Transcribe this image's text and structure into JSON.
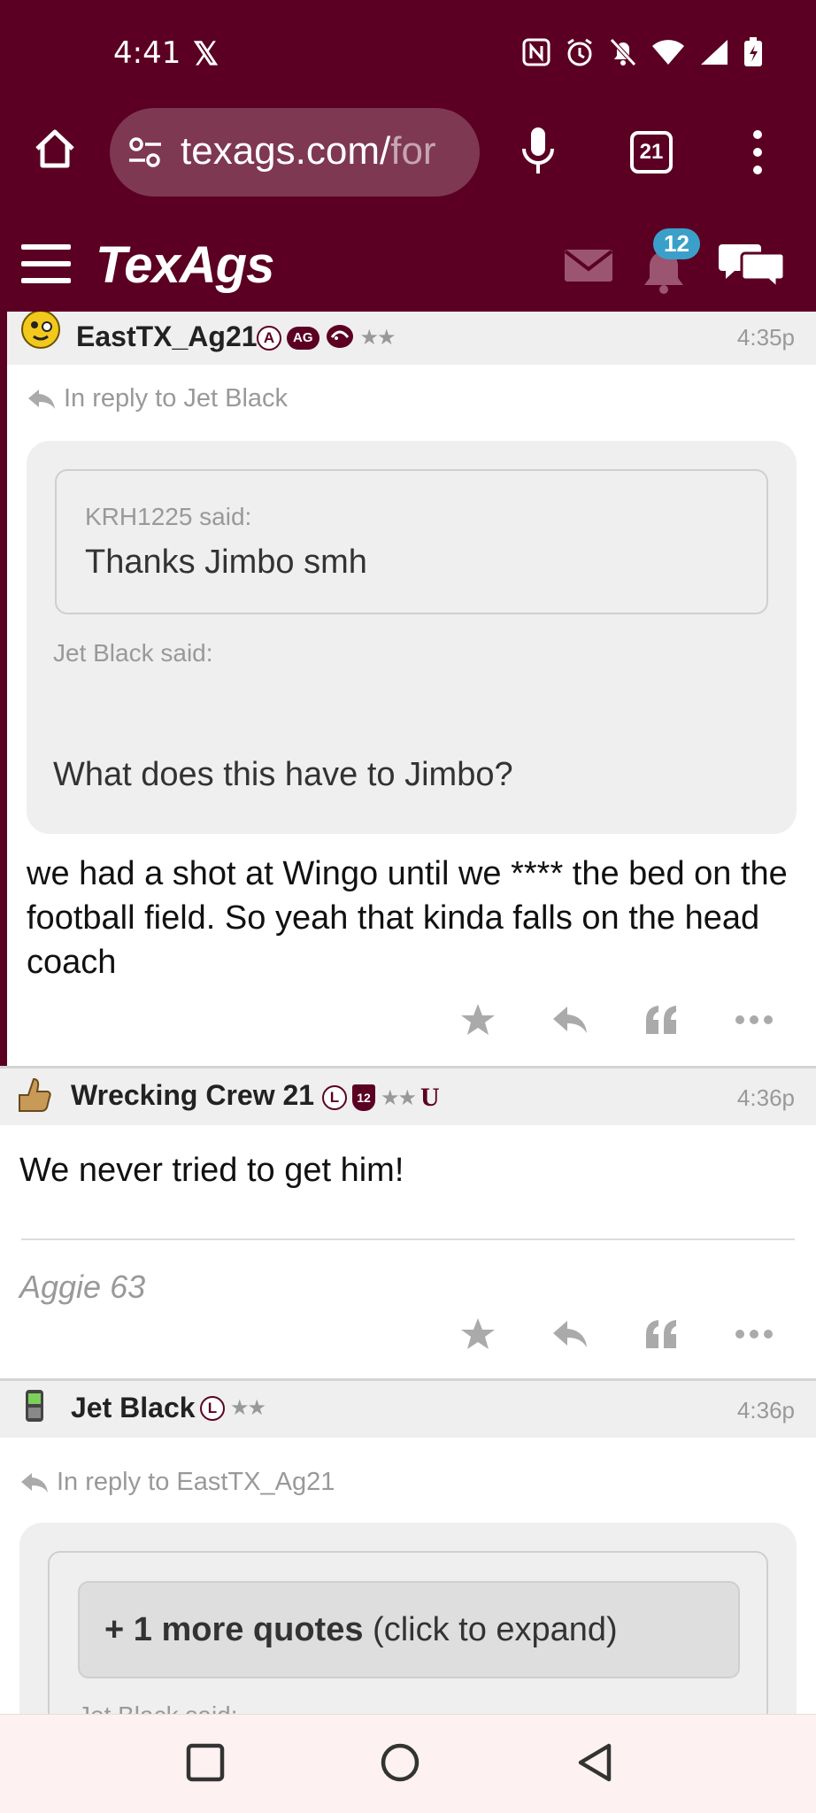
{
  "status_bar": {
    "time": "4:41",
    "x_app": "𝕏",
    "icons": [
      "nfc-icon",
      "alarm-icon",
      "mute-icon",
      "wifi-icon",
      "signal-icon",
      "battery-charging-icon"
    ]
  },
  "browser": {
    "url_main": "texags.com/",
    "url_fade": "for",
    "tab_count": "21"
  },
  "site": {
    "logo": "TexAgs",
    "notification_count": "12",
    "brand_color": "#5b0022",
    "badge_color": "#3ba0c9"
  },
  "posts": [
    {
      "username": "EastTX_Ag21",
      "badge_letter": "A",
      "badge_pill": "AG",
      "stars": "★★",
      "time": "4:35p",
      "reply_to": "In reply to Jet Black",
      "inner_quote_author": "KRH1225 said:",
      "inner_quote_text": "Thanks Jimbo smh",
      "outer_quote_author": "Jet Black said:",
      "outer_quote_text": "What does this have to Jimbo?",
      "body": "we had a shot at Wingo until we **** the bed on the football field. So yeah that kinda falls on the head coach"
    },
    {
      "username": "Wrecking Crew 21",
      "badge_letter": "L",
      "badge_square": "12",
      "stars": "★★",
      "badge_u": "U",
      "time": "4:36p",
      "body": "We never tried to get him!",
      "signature": "Aggie 63"
    },
    {
      "username": "Jet Black",
      "badge_letter": "L",
      "stars": "★★",
      "time": "4:36p",
      "reply_to": "In reply to EastTX_Ag21",
      "expand_bold": "+ 1 more quotes",
      "expand_rest": " (click to expand)",
      "cut_said": "Jet Black said:"
    }
  ]
}
